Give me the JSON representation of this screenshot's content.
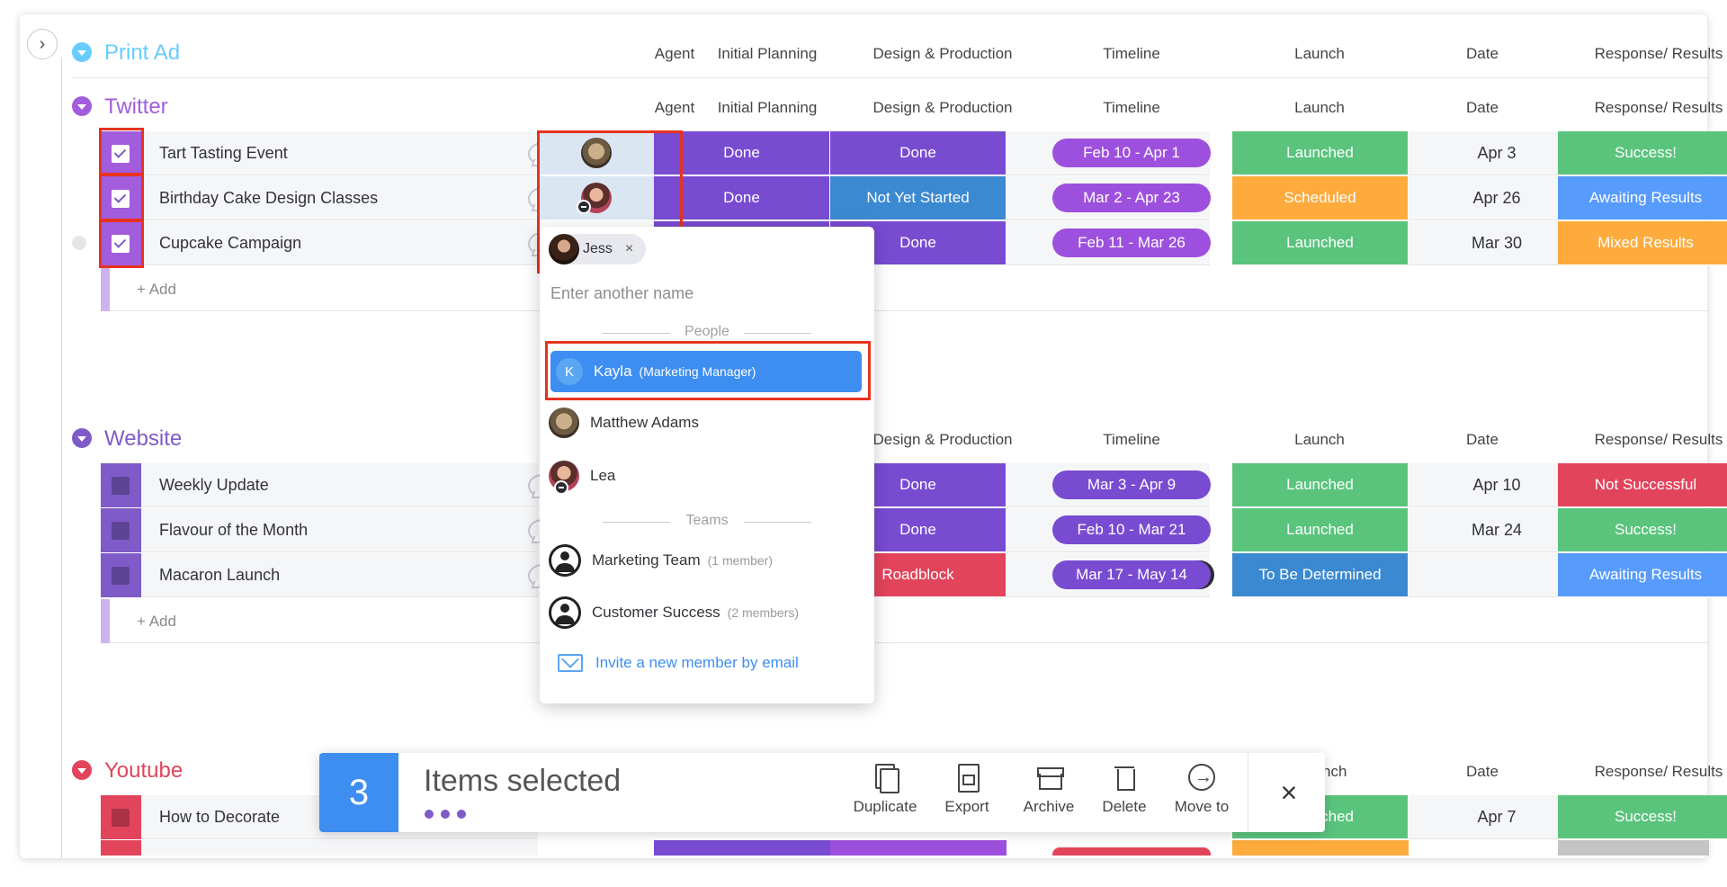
{
  "columns": [
    "Agent",
    "Initial Planning",
    "Design & Production",
    "Timeline",
    "Launch",
    "Date",
    "Response/ Results"
  ],
  "groups": {
    "print_ad": {
      "title": "Print Ad",
      "color": "#66ccff"
    },
    "twitter": {
      "title": "Twitter",
      "color": "#a25ddc",
      "rows": [
        {
          "name": "Tart Tasting Event",
          "planning": "Done",
          "design": "Done",
          "timeline": "Feb 10 - Apr 1",
          "launch": "Launched",
          "date": "Apr 3",
          "result": "Success!"
        },
        {
          "name": "Birthday Cake Design Classes",
          "planning": "Done",
          "design": "Not Yet Started",
          "timeline": "Mar 2 - Apr 23",
          "launch": "Scheduled",
          "date": "Apr 26",
          "result": "Awaiting Results"
        },
        {
          "name": "Cupcake Campaign",
          "planning": "",
          "design": "Done",
          "timeline": "Feb 11 - Mar 26",
          "launch": "Launched",
          "date": "Mar 30",
          "result": "Mixed Results"
        }
      ],
      "add_label": "+ Add"
    },
    "website": {
      "title": "Website",
      "color": "#7e5bc7",
      "rows": [
        {
          "name": "Weekly Update",
          "design": "Done",
          "timeline": "Mar 3 - Apr 9",
          "launch": "Launched",
          "date": "Apr 10",
          "result": "Not Successful"
        },
        {
          "name": "Flavour of the Month",
          "design": "Done",
          "timeline": "Feb 10 - Mar 21",
          "launch": "Launched",
          "date": "Mar 24",
          "result": "Success!"
        },
        {
          "name": "Macaron Launch",
          "design": "Roadblock",
          "timeline": "Mar 17 - May 14",
          "launch": "To Be Determined",
          "date": "",
          "result": "Awaiting Results"
        }
      ],
      "add_label": "+ Add"
    },
    "youtube": {
      "title": "Youtube",
      "color": "#e2445c",
      "rows": [
        {
          "name": "How to Decorate",
          "launch": "ched",
          "date": "Apr 7",
          "result": "Success!"
        }
      ],
      "partial_launch_header": "nch"
    }
  },
  "dropdown": {
    "chip_name": "Jess",
    "chip_remove": "×",
    "input_placeholder": "Enter another name",
    "people_label": "People",
    "teams_label": "Teams",
    "people": [
      {
        "initial": "K",
        "name": "Kayla",
        "role": "(Marketing Manager)"
      },
      {
        "name": "Matthew Adams"
      },
      {
        "name": "Lea"
      }
    ],
    "teams": [
      {
        "name": "Marketing Team",
        "members": "(1 member)"
      },
      {
        "name": "Customer Success",
        "members": "(2 members)"
      }
    ],
    "invite": "Invite a new member by email"
  },
  "selection_bar": {
    "count": "3",
    "label": "Items selected",
    "actions": [
      "Duplicate",
      "Export",
      "Archive",
      "Delete",
      "Move to"
    ],
    "close": "×"
  },
  "colors": {
    "done": "#784bd1",
    "launched": "#5ac47d",
    "scheduled": "#fdab3d",
    "success": "#5ac47d",
    "awaiting": "#579bfc",
    "mixed": "#fdab3d",
    "not_successful": "#e2445c",
    "roadblock": "#e2445c",
    "tbd": "#3b89d0",
    "timeline_pill": "#9d50dd",
    "not_yet_started": "#3b89d0",
    "accent": "#3d8ef0"
  }
}
